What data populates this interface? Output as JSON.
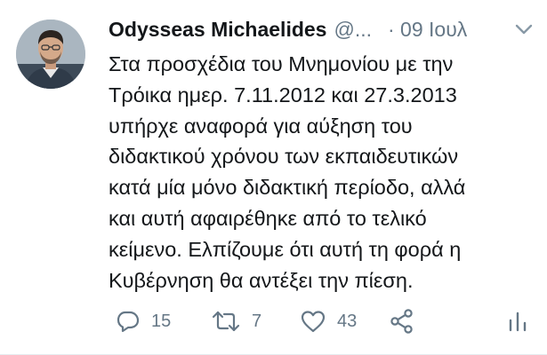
{
  "tweet": {
    "author": {
      "name": "Odysseas Michaelides",
      "handle": "@...",
      "avatar_icon": "profile-photo"
    },
    "time": "· 09 Ιουλ",
    "text_lines": [
      "Στα προσχέδια του Μνημονίου με την",
      "Τρόικα ημερ. 7.11.2012 και 27.3.2013",
      "υπήρχε αναφορά για αύξηση του",
      "διδακτικού χρόνου των εκπαιδευτικών",
      "κατά μία μόνο διδακτική περίοδο, αλλά",
      "και αυτή αφαιρέθηκε από το τελικό",
      "κείμενο. Ελπίζουμε ότι αυτή τη φορά η",
      "Κυβέρνηση θα αντέξει την πίεση."
    ],
    "actions": {
      "reply_count": "15",
      "retweet_count": "7",
      "like_count": "43"
    },
    "colors": {
      "text": "#14171a",
      "secondary": "#657786"
    }
  }
}
